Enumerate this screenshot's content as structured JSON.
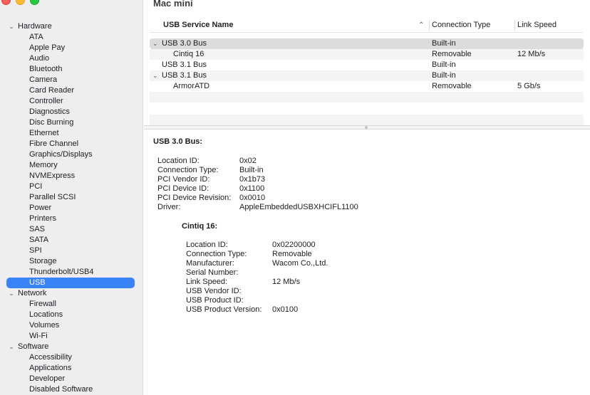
{
  "window": {
    "title": "Mac mini"
  },
  "sidebar": {
    "groups": [
      {
        "label": "Hardware",
        "items": [
          "ATA",
          "Apple Pay",
          "Audio",
          "Bluetooth",
          "Camera",
          "Card Reader",
          "Controller",
          "Diagnostics",
          "Disc Burning",
          "Ethernet",
          "Fibre Channel",
          "Graphics/Displays",
          "Memory",
          "NVMExpress",
          "PCI",
          "Parallel SCSI",
          "Power",
          "Printers",
          "SAS",
          "SATA",
          "SPI",
          "Storage",
          "Thunderbolt/USB4",
          "USB"
        ]
      },
      {
        "label": "Network",
        "items": [
          "Firewall",
          "Locations",
          "Volumes",
          "Wi-Fi"
        ]
      },
      {
        "label": "Software",
        "items": [
          "Accessibility",
          "Applications",
          "Developer",
          "Disabled Software"
        ]
      }
    ],
    "selected": "USB"
  },
  "table": {
    "headers": {
      "name": "USB Service Name",
      "connection": "Connection Type",
      "speed": "Link Speed"
    },
    "rows": [
      {
        "name": "USB 3.0 Bus",
        "connection": "Built-in",
        "speed": ""
      },
      {
        "name": "Cintiq 16",
        "connection": "Removable",
        "speed": "12 Mb/s"
      },
      {
        "name": "USB 3.1 Bus",
        "connection": "Built-in",
        "speed": ""
      },
      {
        "name": "USB 3.1 Bus",
        "connection": "Built-in",
        "speed": ""
      },
      {
        "name": "ArmorATD",
        "connection": "Removable",
        "speed": "5 Gb/s"
      }
    ]
  },
  "detail": {
    "heading": "USB 3.0 Bus:",
    "fields": [
      {
        "key": "Location ID:",
        "value": "0x02"
      },
      {
        "key": "Connection Type:",
        "value": "Built-in"
      },
      {
        "key": "PCI Vendor ID:",
        "value": "0x1b73"
      },
      {
        "key": "PCI Device ID:",
        "value": "0x1100"
      },
      {
        "key": "PCI Device Revision:",
        "value": "0x0010"
      },
      {
        "key": "Driver:",
        "value": "AppleEmbeddedUSBXHCIFL1100"
      }
    ],
    "sub_heading": "Cintiq 16:",
    "sub_fields": [
      {
        "key": "Location ID:",
        "value": "0x02200000"
      },
      {
        "key": "Connection Type:",
        "value": "Removable"
      },
      {
        "key": "Manufacturer:",
        "value": "Wacom Co.,Ltd."
      },
      {
        "key": "Serial Number:",
        "value": ""
      },
      {
        "key": "Link Speed:",
        "value": "12 Mb/s"
      },
      {
        "key": "USB Vendor ID:",
        "value": ""
      },
      {
        "key": "USB Product ID:",
        "value": ""
      },
      {
        "key": "USB Product Version:",
        "value": "0x0100"
      }
    ]
  }
}
